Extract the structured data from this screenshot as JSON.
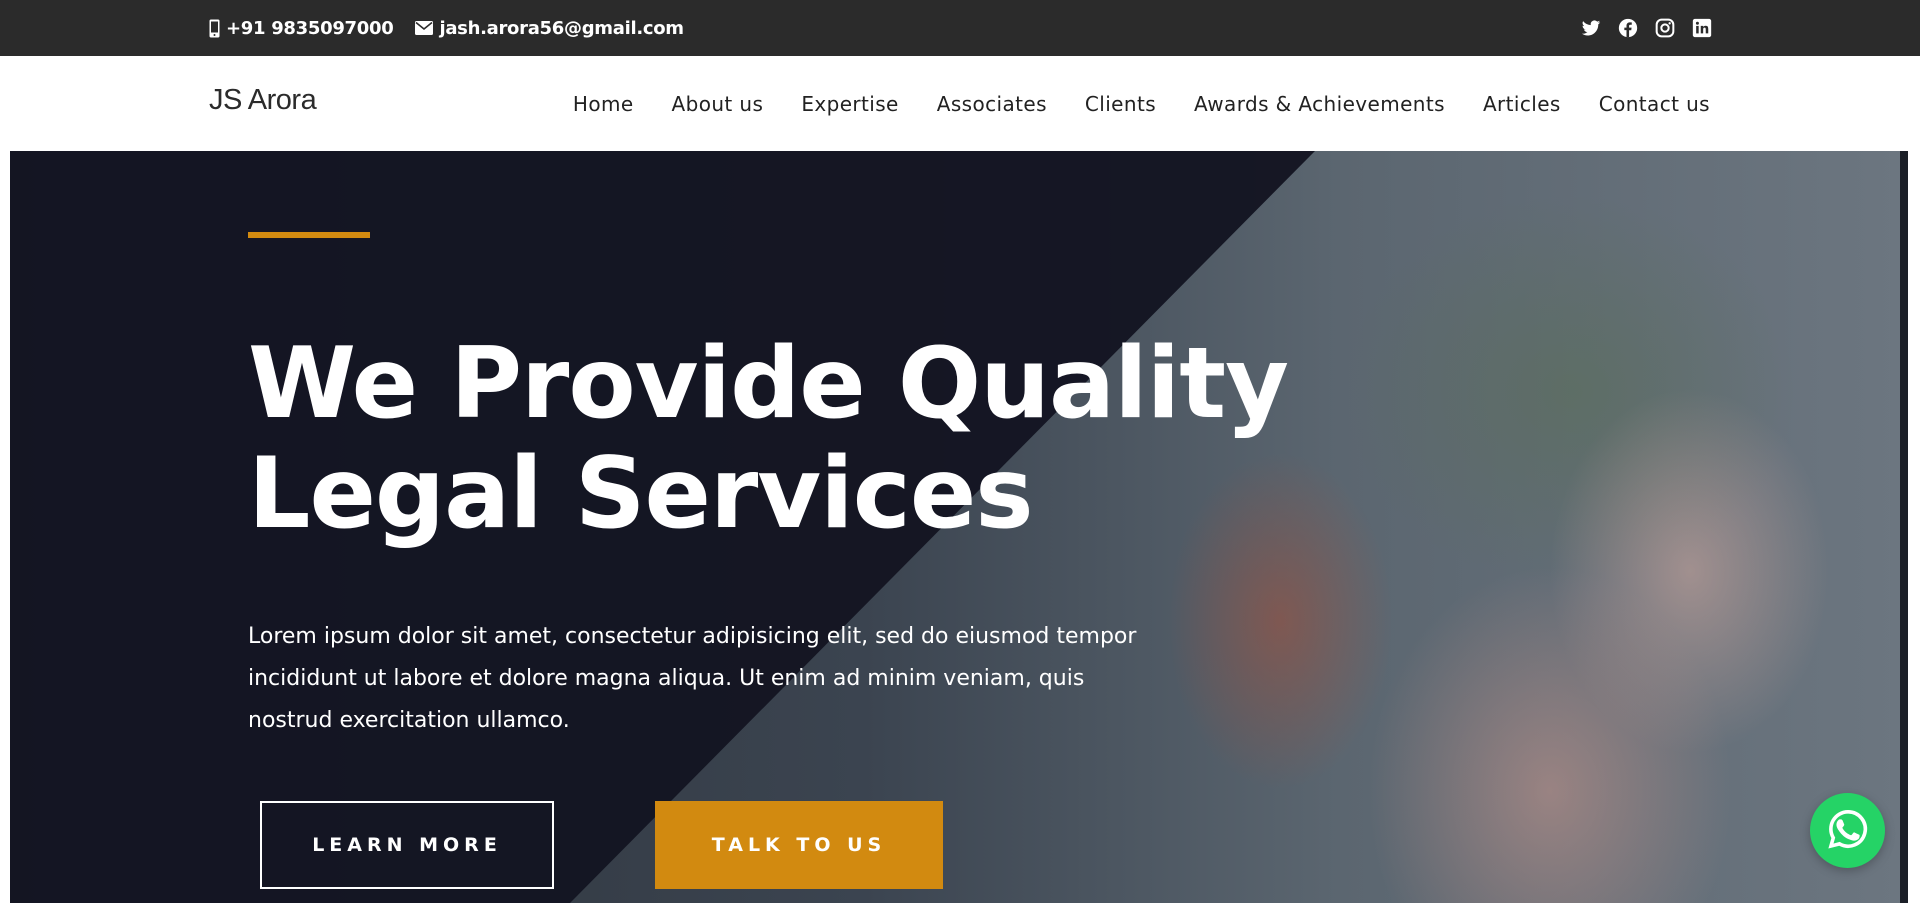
{
  "topbar": {
    "phone": "+91 9835097000",
    "email": "jash.arora56@gmail.com",
    "social": [
      "twitter-icon",
      "facebook-icon",
      "instagram-icon",
      "linkedin-icon"
    ]
  },
  "header": {
    "brand": "JS Arora",
    "nav": [
      "Home",
      "About us",
      "Expertise",
      "Associates",
      "Clients",
      "Awards & Achievements",
      "Articles",
      "Contact us"
    ]
  },
  "hero": {
    "title_line1": "We Provide Quality",
    "title_line2": "Legal Services",
    "text": "Lorem ipsum dolor sit amet, consectetur adipisicing elit, sed do eiusmod tempor incididunt ut labore et dolore magna aliqua. Ut enim ad minim veniam, quis nostrud exercitation ullamco.",
    "learn_more": "LEARN MORE",
    "talk_to_us": "TALK TO US"
  },
  "colors": {
    "topbar": "#2b2b2b",
    "accent": "#d28a10",
    "hero_overlay": "#141522",
    "whatsapp": "#25d366"
  },
  "floating": {
    "whatsapp_icon": "whatsapp-icon"
  }
}
